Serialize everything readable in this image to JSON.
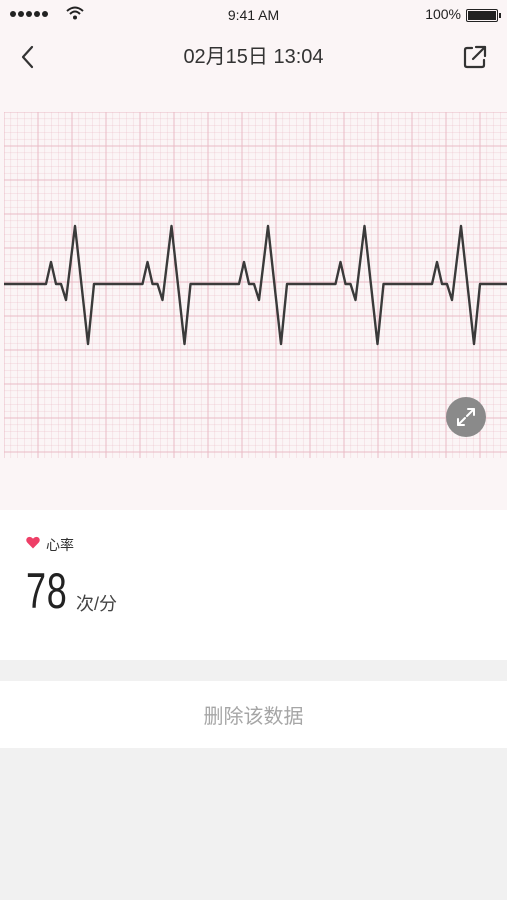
{
  "status_bar": {
    "time": "9:41 AM",
    "battery": "100%",
    "signal_icon": "signal-dots-icon",
    "wifi_icon": "wifi-icon",
    "battery_icon": "battery-icon"
  },
  "nav": {
    "title": "02月15日 13:04",
    "back_icon": "chevron-left-icon",
    "share_icon": "external-link-icon"
  },
  "ecg": {
    "expand_icon": "expand-icon",
    "grid_color": "#e9b8c3",
    "trace_color": "#3a3a3a"
  },
  "heart_rate": {
    "icon": "heart-icon",
    "icon_color": "#ee3f67",
    "label": "心率",
    "value": "78",
    "unit": "次/分"
  },
  "actions": {
    "delete_label": "删除该数据"
  }
}
